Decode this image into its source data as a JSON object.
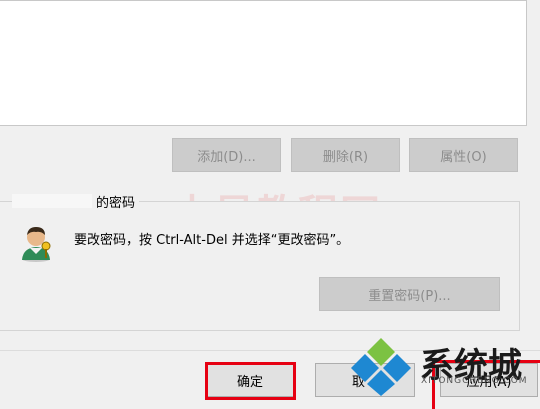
{
  "list_buttons": {
    "add": "添加(D)...",
    "remove": "删除(R)",
    "properties": "属性(O)"
  },
  "password_group": {
    "title": "的密码",
    "message": "要改密码，按 Ctrl-Alt-Del 并选择“更改密码”。",
    "reset_button": "重置密码(P)..."
  },
  "dialog_buttons": {
    "ok": "确定",
    "cancel": "取",
    "apply": "应用(A)"
  },
  "watermark": "木星教程网",
  "brand": {
    "name": "系统城",
    "sub": "XITONGCHENG.COM"
  },
  "colors": {
    "highlight": "#e60012",
    "brand_blue": "#1e88d2",
    "brand_green": "#7cc242"
  }
}
